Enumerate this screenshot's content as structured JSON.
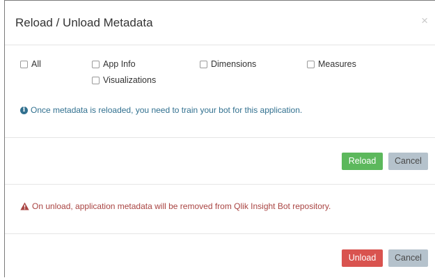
{
  "modal": {
    "title": "Reload / Unload Metadata",
    "close_glyph": "×"
  },
  "checkboxes": [
    {
      "label": "All",
      "checked": false
    },
    {
      "label": "App Info",
      "checked": false
    },
    {
      "label": "Dimensions",
      "checked": false
    },
    {
      "label": "Measures",
      "checked": false
    },
    {
      "label": "Visualizations",
      "checked": false
    }
  ],
  "reload_section": {
    "info_icon": "info-circle-icon",
    "info_text": "Once metadata is reloaded, you need to train your bot for this application.",
    "reload_label": "Reload",
    "cancel_label": "Cancel"
  },
  "unload_section": {
    "warning_icon": "warning-triangle-icon",
    "warning_text": "On unload, application metadata will be removed from Qlik Insight Bot repository.",
    "unload_label": "Unload",
    "cancel_label": "Cancel"
  },
  "colors": {
    "info": "#31708f",
    "warning": "#a94442",
    "reload_button": "#5cb85c",
    "unload_button": "#d9534f",
    "cancel_button": "#b5c2cc"
  }
}
